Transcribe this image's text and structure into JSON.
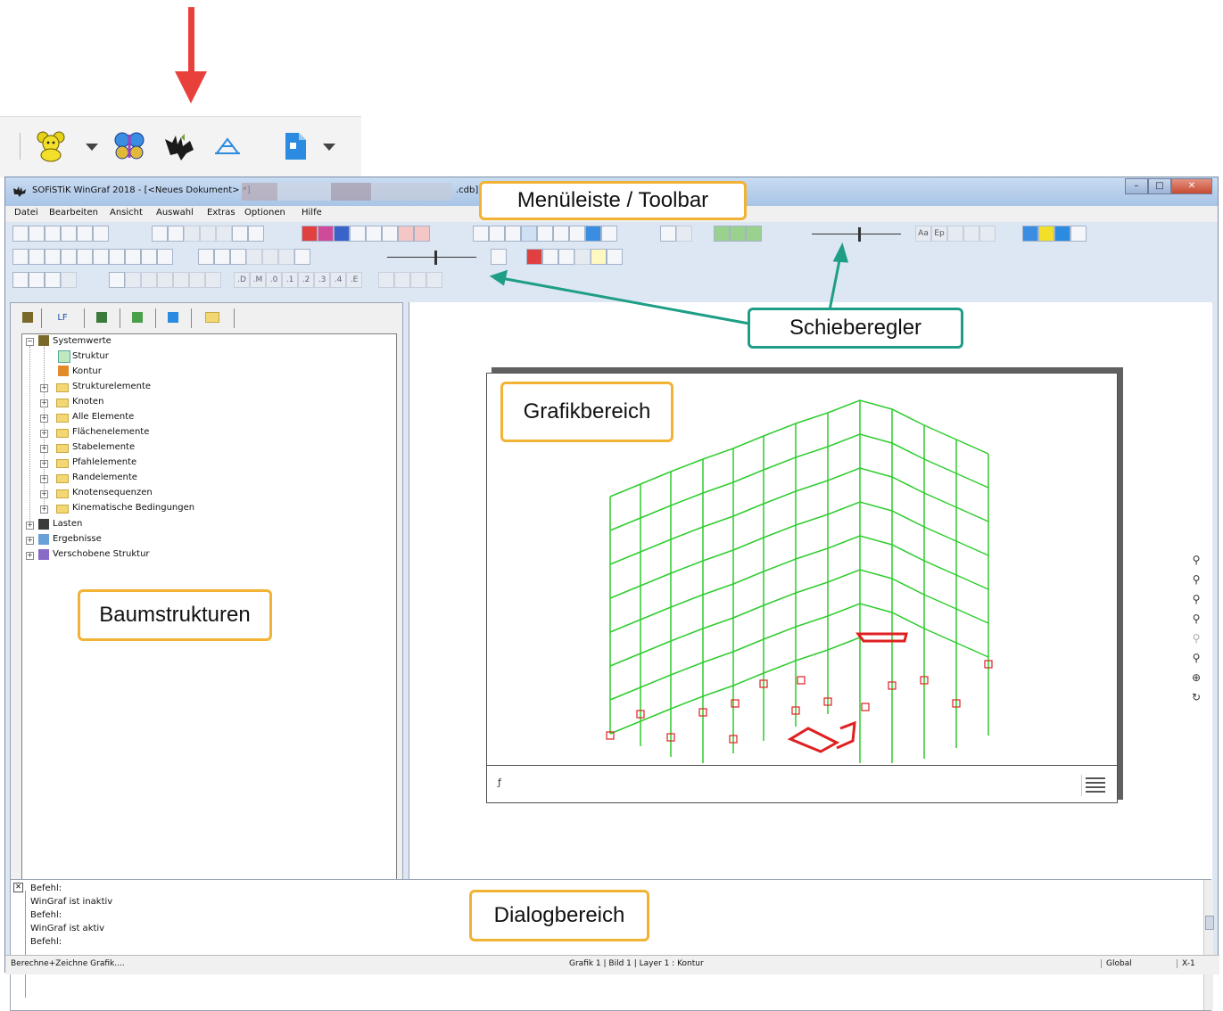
{
  "zoom_toolbar": {
    "icons": [
      "teddy-bear-icon",
      "butterfly-icon",
      "bat-icon",
      "sofistik-structure-icon",
      "document-icon"
    ]
  },
  "window": {
    "title": "SOFiSTiK WinGraf 2018 - [<Neues Dokument> *]",
    "title_suffix": ".cdb]",
    "buttons": {
      "minimize": "–",
      "maximize": "□",
      "close": "✕"
    }
  },
  "menu": [
    "Datei",
    "Bearbeiten",
    "Ansicht",
    "Auswahl",
    "Extras",
    "Optionen",
    "Hilfe"
  ],
  "toolbar": {
    "row3_labels": [
      ".D",
      ".M",
      ".0",
      ".1",
      ".2",
      ".3",
      ".4",
      ".E"
    ],
    "font_labels": [
      "Aa",
      "Ep"
    ]
  },
  "tree": {
    "tabs": [
      "LF"
    ],
    "items": [
      {
        "label": "Systemwerte",
        "level": 0,
        "expanded": true
      },
      {
        "label": "Struktur",
        "level": 1
      },
      {
        "label": "Kontur",
        "level": 1
      },
      {
        "label": "Strukturelemente",
        "level": 1
      },
      {
        "label": "Knoten",
        "level": 1
      },
      {
        "label": "Alle Elemente",
        "level": 1
      },
      {
        "label": "Flächenelemente",
        "level": 1
      },
      {
        "label": "Stabelemente",
        "level": 1
      },
      {
        "label": "Pfahlelemente",
        "level": 1
      },
      {
        "label": "Randelemente",
        "level": 1
      },
      {
        "label": "Knotensequenzen",
        "level": 1
      },
      {
        "label": "Kinematische Bedingungen",
        "level": 1
      },
      {
        "label": "Lasten",
        "level": 0
      },
      {
        "label": "Ergebnisse",
        "level": 0
      },
      {
        "label": "Verschobene Struktur",
        "level": 0
      }
    ]
  },
  "dialog": {
    "lines": [
      "Befehl:",
      "WinGraf ist inaktiv",
      "Befehl:",
      "WinGraf ist aktiv",
      "Befehl:"
    ]
  },
  "status": {
    "left": "Berechne+Zeichne Grafik....",
    "middle": "Grafik   1 | Bild   1 | Layer   1 : Kontur",
    "coord": "Global",
    "axis": "X-1"
  },
  "callouts": {
    "menu_toolbar": "Menüleiste / Toolbar",
    "slider": "Schieberegler",
    "graphic": "Grafikbereich",
    "tree": "Baumstrukturen",
    "dialog": "Dialogbereich"
  },
  "colors": {
    "arrow": "#e8413c",
    "callout_orange": "#f2b233",
    "callout_teal": "#1e9e86",
    "structure": "#2ecc2e",
    "supports": "#e02020"
  }
}
